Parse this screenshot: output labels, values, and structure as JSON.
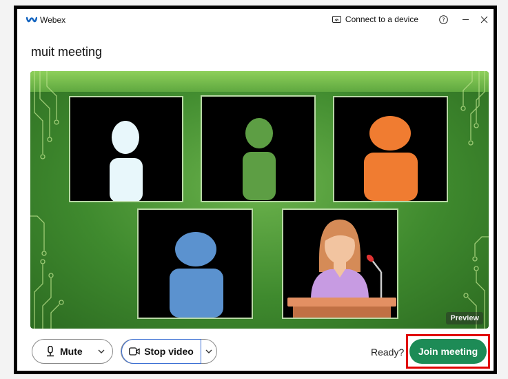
{
  "app": {
    "name": "Webex"
  },
  "titlebar": {
    "connect_label": "Connect to a device",
    "help_icon": "help-icon",
    "minimize_icon": "minimize-icon",
    "close_icon": "close-icon"
  },
  "meeting": {
    "title": "muit meeting"
  },
  "preview": {
    "label": "Preview"
  },
  "controls": {
    "mute_label": "Mute",
    "stop_video_label": "Stop video",
    "ready_text": "Ready?",
    "join_label": "Join meeting"
  },
  "colors": {
    "join": "#1d8b56",
    "highlight": "#e00000",
    "stage_green": "#4e9a36"
  }
}
